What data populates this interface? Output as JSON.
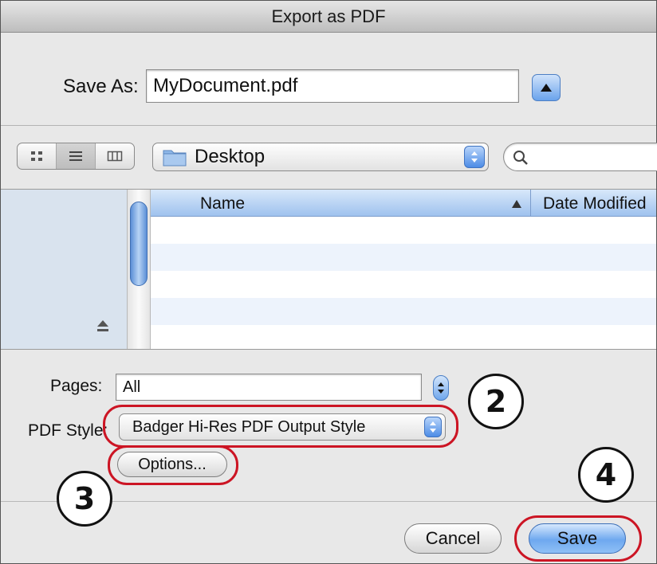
{
  "window": {
    "title": "Export as PDF"
  },
  "save_as": {
    "label": "Save As:",
    "filename": "MyDocument.pdf"
  },
  "toolbar": {
    "view_modes": [
      "icon-view",
      "list-view",
      "column-view"
    ],
    "active_view": "list-view",
    "location": "Desktop",
    "search_placeholder": ""
  },
  "file_list": {
    "columns": [
      "Name",
      "Date Modified"
    ],
    "sort_column": "Name",
    "rows": []
  },
  "options": {
    "pages_label": "Pages:",
    "pages_value": "All",
    "pdf_style_label": "PDF Style:",
    "pdf_style_value": "Badger Hi-Res PDF Output Style",
    "options_button": "Options..."
  },
  "buttons": {
    "cancel": "Cancel",
    "save": "Save"
  },
  "annotations": {
    "step_2": "2",
    "step_3": "3",
    "step_4": "4"
  },
  "colors": {
    "accent_blue": "#6ea8ef",
    "callout_red": "#cc1524",
    "sidebar": "#d9e3ee"
  }
}
